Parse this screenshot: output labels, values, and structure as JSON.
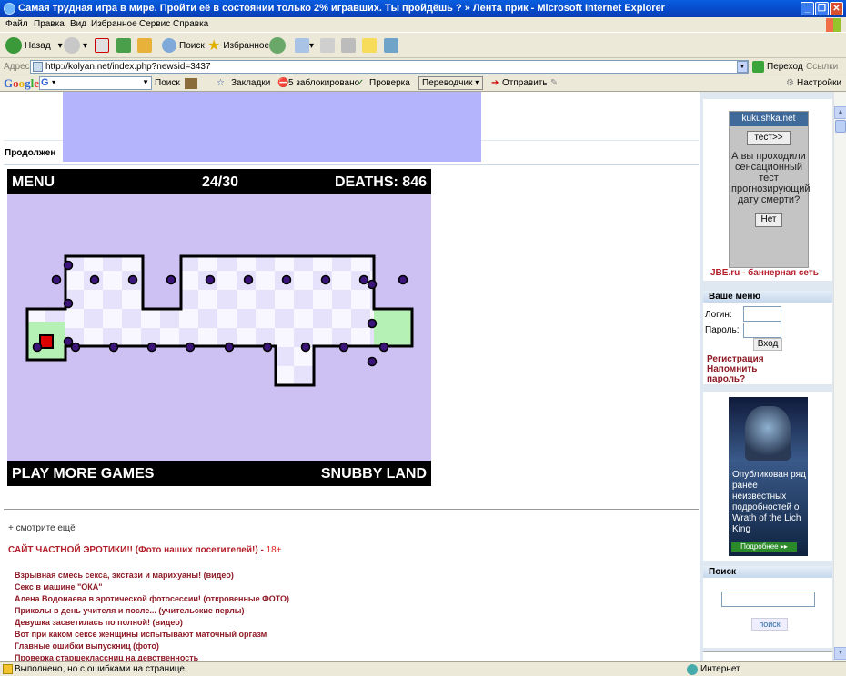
{
  "window": {
    "title": "Самая трудная игра в мире. Пройти её в состоянии только 2% игравших. Ты пройдёшь ? » Лента прик - Microsoft Internet Explorer"
  },
  "menu": [
    "Файл",
    "Правка",
    "Вид",
    "Избранное",
    "Сервис",
    "Справка"
  ],
  "toolbar": {
    "back": "Назад",
    "search": "Поиск",
    "favorites": "Избранное"
  },
  "address": {
    "label": "Адрес:",
    "url": "http://kolyan.net/index.php?newsid=3437",
    "go": "Переход",
    "links": "Ссылки"
  },
  "google": {
    "logo": "Google",
    "search": "Поиск",
    "bookmarks": "Закладки",
    "blocked": "5 заблокировано",
    "check": "Проверка",
    "translate": "Переводчик",
    "send": "Отправить",
    "settings": "Настройки"
  },
  "page": {
    "continue_tab": "Продолжен",
    "more_link": "+ смотрите ещё"
  },
  "game": {
    "menu": "MENU",
    "level": "24/30",
    "deaths": "DEATHS: 846",
    "play_more": "PLAY MORE GAMES",
    "brand": "SNUBBY LAND",
    "colors": {
      "bg": "#cdc0f2",
      "start_zone": "#b5f0b5",
      "player": "#dd0000",
      "enemy": "#3a1478"
    }
  },
  "ero": {
    "title": "САЙТ ЧАСТНОЙ ЭРОТИКИ!! (Фото наших посетителей!) - ",
    "age": "18+",
    "links": [
      "Взрывная смесь секса, экстази и марихуаны! (видео)",
      "Секс в машине \"ОКА\"",
      "Алена Водонаева в эротической фотосессии! (откровенные ФОТО)",
      "Приколы в день учителя и после... (учительские перлы)",
      "Девушка засветилась по полной! (видео)",
      "Вот при каком сексе женщины испытывают маточный оргазм",
      "Главные ошибки выпускниц (фото)",
      "Проверка старшеклассниц на девственность"
    ]
  },
  "sidebar": {
    "ad": {
      "site": "kukushka.net",
      "test_btn": "тест>>",
      "text": "А вы проходили сенсационный тест прогнозирующий дату смерти?",
      "no_btn": "Нет",
      "network": "JBE.ru - баннерная сеть"
    },
    "menu": {
      "title": "Ваше меню",
      "login": "Логин:",
      "password": "Пароль:",
      "enter": "Вход",
      "register": "Регистрация",
      "remind": "Напомнить",
      "remind2": "пароль?"
    },
    "wow": {
      "text": "Опубликован ряд ранее неизвестных подробностей о Wrath of the Lich King",
      "btn": "Подробнее ▸▸"
    },
    "search": {
      "title": "Поиск",
      "btn": "поиск"
    }
  },
  "status": {
    "text": "Выполнено, но с ошибками на странице.",
    "zone": "Интернет"
  }
}
